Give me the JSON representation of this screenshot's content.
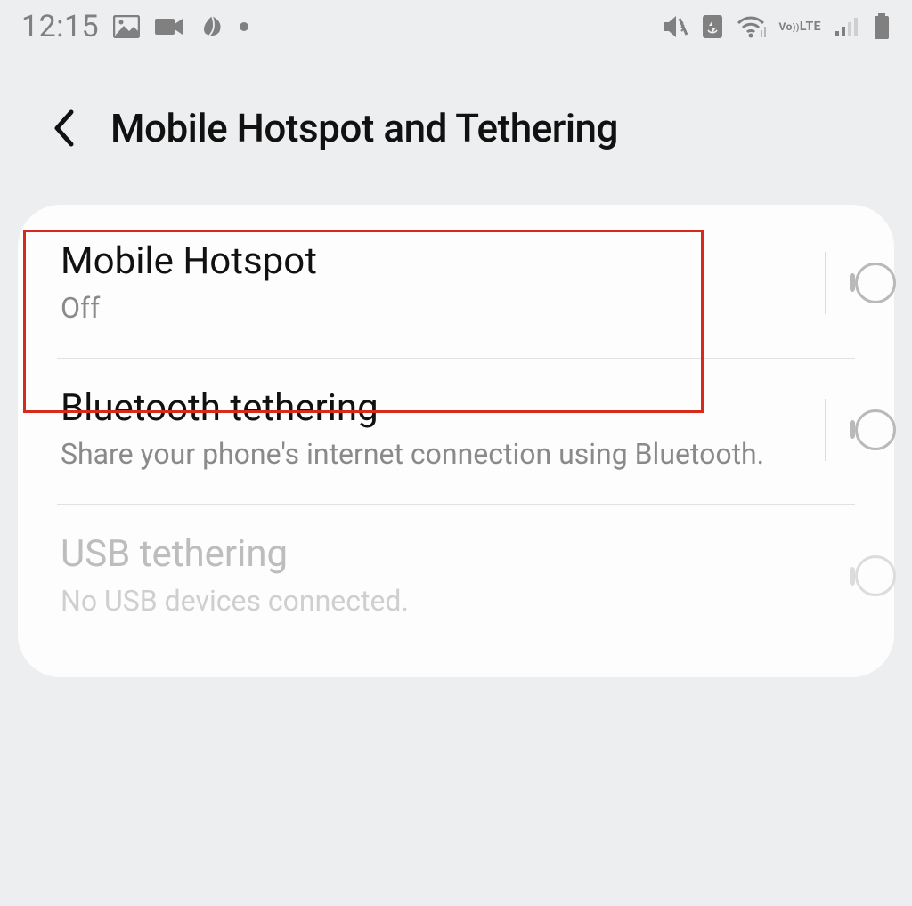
{
  "status_bar": {
    "time": "12:15",
    "left_icons": [
      "image-icon",
      "camera-icon",
      "leaf-icon",
      "dot-icon"
    ],
    "right_icons": [
      "vibrate-mute-icon",
      "data-saver-icon",
      "wifi-icon",
      "volte-icon",
      "signal-icon",
      "battery-icon"
    ],
    "volte_label": "Vo LTE"
  },
  "header": {
    "title": "Mobile Hotspot and Tethering"
  },
  "settings": {
    "items": [
      {
        "id": "mobile-hotspot",
        "title": "Mobile Hotspot",
        "subtitle": "Off",
        "enabled": true,
        "toggled": false,
        "highlighted": true
      },
      {
        "id": "bluetooth-tethering",
        "title": "Bluetooth tethering",
        "subtitle": "Share your phone's internet connection using Bluetooth.",
        "enabled": true,
        "toggled": false,
        "highlighted": false
      },
      {
        "id": "usb-tethering",
        "title": "USB tethering",
        "subtitle": "No USB devices connected.",
        "enabled": false,
        "toggled": false,
        "highlighted": false
      }
    ]
  }
}
